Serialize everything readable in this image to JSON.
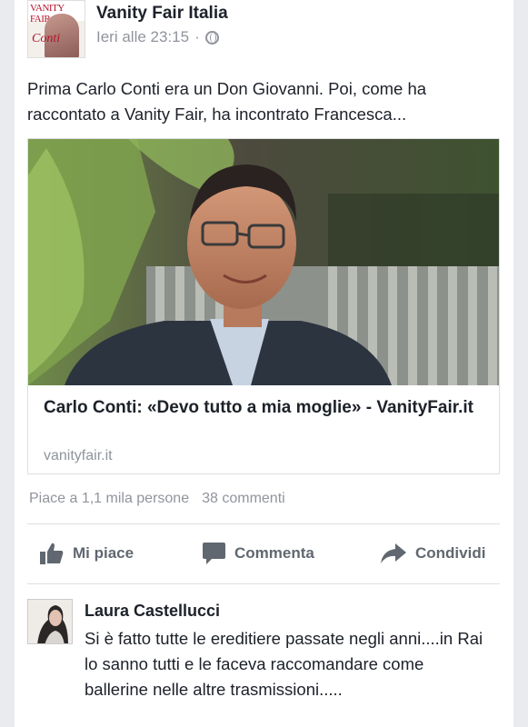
{
  "post": {
    "page_name": "Vanity Fair Italia",
    "timestamp": "Ieri alle 23:15",
    "separator": "·",
    "text": "Prima Carlo Conti era un Don Giovanni. Poi, come ha raccontato a Vanity Fair, ha incontrato Francesca..."
  },
  "avatar": {
    "title": "VANITY FAIR",
    "word": "Conti"
  },
  "link": {
    "title": "Carlo Conti: «Devo tutto a mia moglie» - VanityFair.it",
    "domain": "vanityfair.it"
  },
  "stats": {
    "likes": "Piace a 1,1 mila persone",
    "comments": "38 commenti"
  },
  "actions": {
    "like": "Mi piace",
    "comment": "Commenta",
    "share": "Condividi"
  },
  "comment": {
    "author": "Laura Castellucci",
    "text": "Si è fatto tutte le ereditiere passate negli anni....in Rai lo sanno tutti e le faceva raccomandare come ballerine nelle altre trasmissioni....."
  },
  "colors": {
    "background": "#e9ebee",
    "text": "#1d2129",
    "muted": "#90949c",
    "action": "#616770"
  },
  "icons": [
    "globe-icon",
    "like-icon",
    "comment-icon",
    "share-icon"
  ]
}
